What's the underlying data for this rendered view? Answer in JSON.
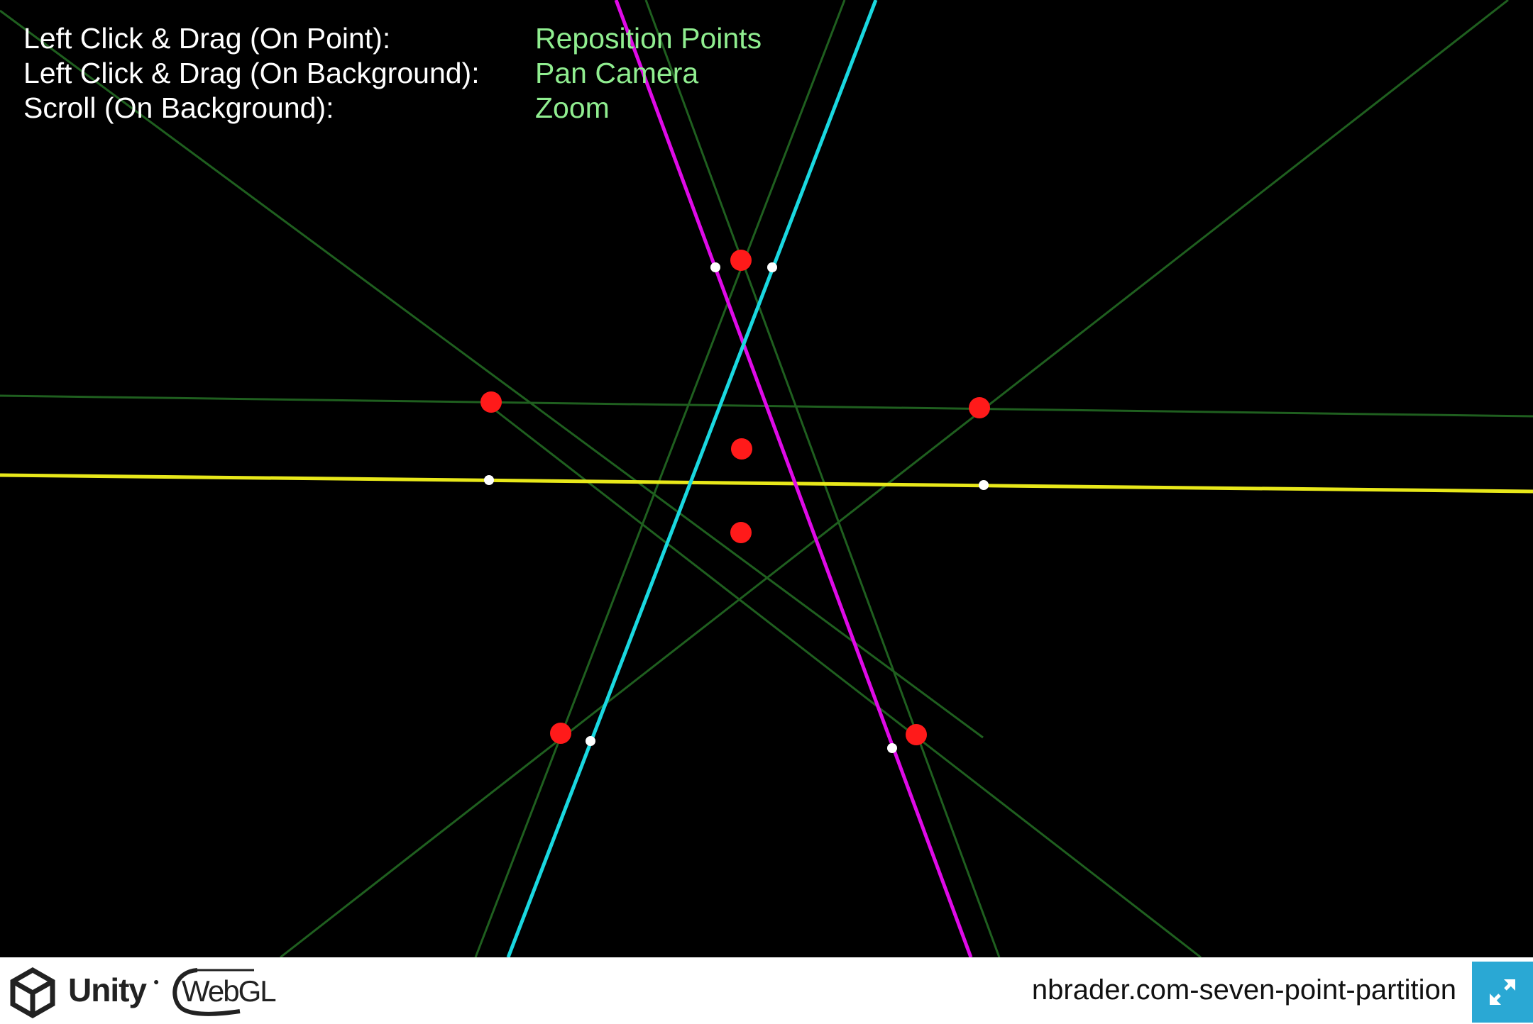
{
  "controls": [
    {
      "key": "Left Click & Drag (On Point):",
      "action": "Reposition Points"
    },
    {
      "key": "Left Click & Drag (On Background):",
      "action": "Pan Camera"
    },
    {
      "key": "Scroll (On Background):",
      "action": "Zoom"
    }
  ],
  "footer": {
    "unity_label": "Unity",
    "webgl_label": "WebGL",
    "build_title": "nbrader.com-seven-point-partition",
    "fullscreen_icon": "expand-arrows-icon"
  },
  "colors": {
    "background": "#000000",
    "control_key": "#ffffff",
    "control_action": "#90ee90",
    "guide_line": "#1f5f1f",
    "partition_line_yellow": "#e8e81a",
    "partition_line_magenta": "#e00ae8",
    "partition_line_cyan": "#1ad8e0",
    "point": "#ff1a1a",
    "marker": "#ffffff",
    "fullscreen_button": "#2aa8d4"
  }
}
